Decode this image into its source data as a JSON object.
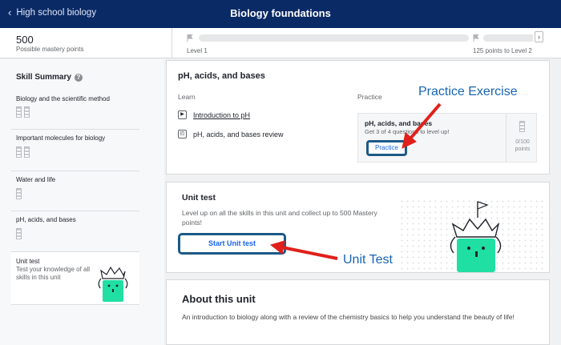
{
  "header": {
    "back_label": "High school biology",
    "title": "Biology foundations"
  },
  "mastery": {
    "points": "500",
    "points_label": "Possible mastery points",
    "level1_label": "Level 1",
    "level2_label": "125 points to Level 2",
    "progress": 0
  },
  "sidebar": {
    "summary_title": "Skill Summary",
    "items": [
      {
        "label": "Biology and the scientific method",
        "bars": 2
      },
      {
        "label": "Important molecules for biology",
        "bars": 2
      },
      {
        "label": "Water and life",
        "bars": 1
      },
      {
        "label": "pH, acids, and bases",
        "bars": 1
      }
    ],
    "unit_test": {
      "title": "Unit test",
      "desc": "Test your knowledge of all skills in this unit"
    }
  },
  "lesson_card": {
    "title": "pH, acids, and bases",
    "learn_header": "Learn",
    "practice_header": "Practice",
    "lessons": [
      {
        "label": "Introduction to pH",
        "icon": "video-icon"
      },
      {
        "label": "pH, acids, and bases review",
        "icon": "article-icon"
      }
    ],
    "practice": {
      "title": "pH, acids, and bases",
      "desc": "Get 3 of 4 questions to level up!",
      "button": "Practice",
      "points": "0/100",
      "points_unit": "points"
    }
  },
  "unit_test_card": {
    "title": "Unit test",
    "desc": "Level up on all the skills in this unit and collect up to 500 Mastery points!",
    "button": "Start Unit test"
  },
  "about_card": {
    "title": "About this unit",
    "desc": "An introduction to biology along with a review of the chemistry basics to help you understand the beauty of life!"
  },
  "annotations": {
    "practice": "Practice Exercise",
    "unit_test": "Unit Test",
    "color": "#1865b0",
    "arrow_color": "#e0201b"
  },
  "colors": {
    "header_bg": "#0a2a66",
    "button_border": "#1c5a86",
    "link_blue": "#1865f2",
    "mascot": "#1fdfa3"
  }
}
